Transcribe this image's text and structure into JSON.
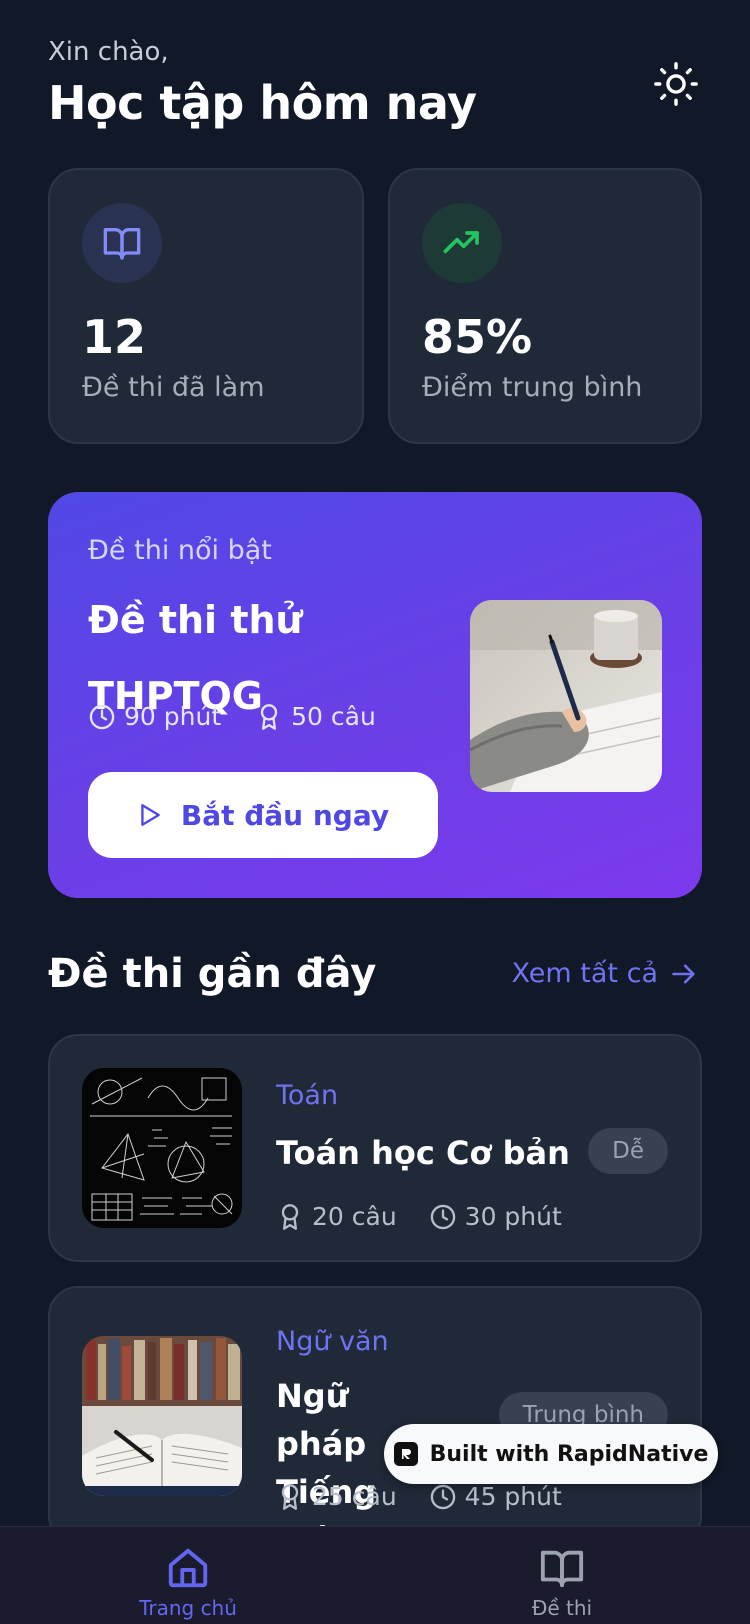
{
  "header": {
    "greeting": "Xin chào,",
    "title": "Học tập hôm nay",
    "theme_icon": "sun-icon"
  },
  "stats": [
    {
      "icon": "book-open-icon",
      "value": "12",
      "label": "Đề thi đã làm",
      "icon_color": "#818cf8"
    },
    {
      "icon": "trending-up-icon",
      "value": "85%",
      "label": "Điểm trung bình",
      "icon_color": "#22c55e"
    }
  ],
  "featured": {
    "kicker": "Đề thi nổi bật",
    "title": "Đề thi thử THPTQG",
    "duration": "90 phút",
    "questions": "50 câu",
    "cta_label": "Bắt đầu ngay",
    "image": "person-writing-exam-photo"
  },
  "recent": {
    "title": "Đề thi gần đây",
    "see_all": "Xem tất cả",
    "items": [
      {
        "category": "Toán",
        "title": "Toán học Cơ bản",
        "questions": "20 câu",
        "duration": "30 phút",
        "difficulty": "Dễ",
        "image": "math-chalkboard-photo"
      },
      {
        "category": "Ngữ văn",
        "title": "Ngữ pháp Tiếng Việt",
        "questions": "25 câu",
        "duration": "45 phút",
        "difficulty": "Trung bình",
        "image": "open-book-photo"
      }
    ]
  },
  "overlay": {
    "label": "Built with RapidNative"
  },
  "tabbar": {
    "tabs": [
      {
        "label": "Trang chủ",
        "icon": "home-icon",
        "active": true
      },
      {
        "label": "Đề thi",
        "icon": "book-open-icon",
        "active": false
      }
    ]
  },
  "colors": {
    "background": "#111827",
    "card": "#1f2937",
    "accent": "#6366f1",
    "featured_gradient": [
      "#5048e5",
      "#7c3aed"
    ]
  }
}
